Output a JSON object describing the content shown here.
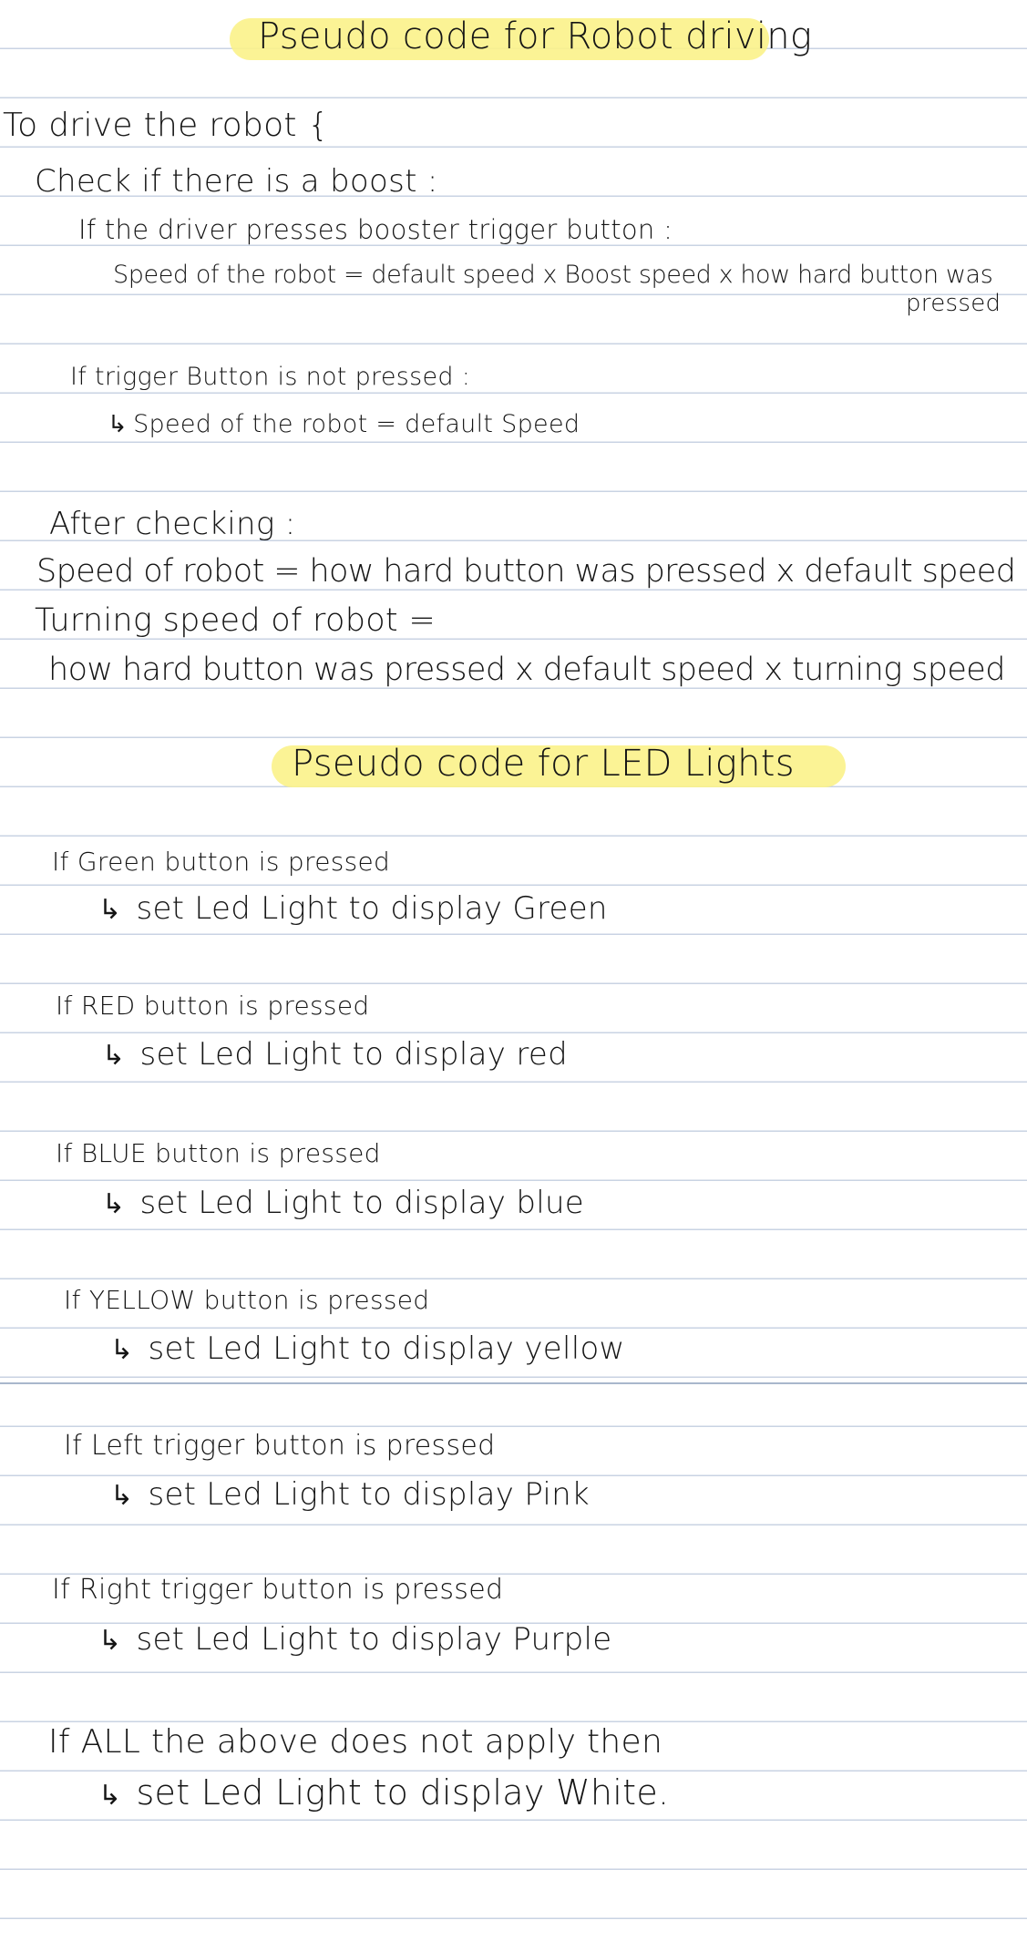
{
  "colors": {
    "highlight": "#fbf289",
    "ink": "#151515",
    "rule_line": "#c9d3e3"
  },
  "icons": {
    "arrow": "↳"
  },
  "robot_section": {
    "title": "Pseudo code for Robot driving",
    "open_line": "To drive the robot {",
    "check_boost": "Check if there is a boost :",
    "if_booster": "If the driver presses booster trigger button :",
    "boost_formula": "Speed of the robot = default speed x Boost speed x how hard button was",
    "boost_formula_cont": "pressed",
    "if_not_pressed": "If trigger Button is not pressed :",
    "default_formula": "Speed of the robot = default Speed",
    "after_checking": "After checking :",
    "speed_formula": "Speed of robot = how hard button was pressed x default speed",
    "turning_label": "Turning speed of robot =",
    "turning_formula": "how hard button was pressed x default speed x turning speed"
  },
  "led_section": {
    "title": "Pseudo code for LED Lights",
    "rules": [
      {
        "condition": "If Green button is pressed",
        "action": "set Led Light to display Green"
      },
      {
        "condition": "If RED button is pressed",
        "action": "set Led Light to display red"
      },
      {
        "condition": "If BLUE button is pressed",
        "action": "set Led Light to display blue"
      },
      {
        "condition": "If YELLOW button is pressed",
        "action": "set Led Light to display yellow"
      },
      {
        "condition": "If Left trigger button is pressed",
        "action": "set Led Light to display Pink"
      },
      {
        "condition": "If Right trigger button is pressed",
        "action": "set Led Light to display Purple"
      }
    ],
    "fallback_condition": "If ALL the above does not apply then",
    "fallback_action": "set Led Light to display White."
  }
}
